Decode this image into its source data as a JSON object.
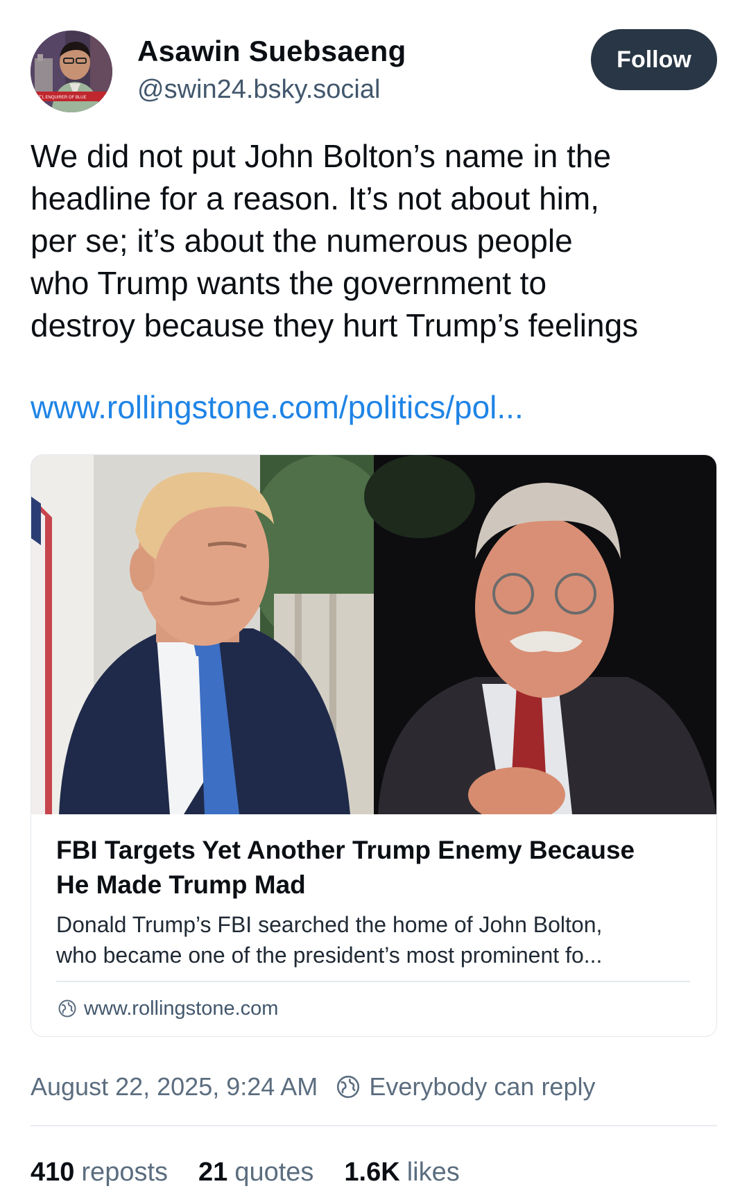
{
  "author": {
    "display_name": "Asawin Suebsaeng",
    "handle": "@swin24.bsky.social",
    "avatar_chyron": "NAT'L ENQUIRER OF BLUE"
  },
  "follow_button": {
    "label": "Follow"
  },
  "post": {
    "text_lines": [
      "We did not put John Bolton’s name in the",
      "headline for a reason. It’s not about him,",
      "per se; it’s about the numerous people",
      "who Trump wants the government to",
      "destroy because they hurt Trump’s feelings"
    ],
    "link_text": "www.rollingstone.com/politics/pol..."
  },
  "link_card": {
    "title_lines": [
      "FBI Targets Yet Another Trump Enemy Because",
      "He Made Trump Mad"
    ],
    "description_lines": [
      "Donald Trump’s FBI searched the home of John Bolton,",
      "who became one of the president’s most prominent fo..."
    ],
    "domain": "www.rollingstone.com",
    "domain_icon": "globe-icon"
  },
  "meta": {
    "timestamp": "August 22, 2025, 9:24 AM",
    "reply_setting": "Everybody can reply",
    "reply_icon": "globe-icon"
  },
  "stats": {
    "reposts": {
      "count": "410",
      "label": "reposts"
    },
    "quotes": {
      "count": "21",
      "label": "quotes"
    },
    "likes": {
      "count": "1.6K",
      "label": "likes"
    }
  },
  "colors": {
    "follow_bg": "#283645",
    "link": "#1f84e6",
    "muted": "#5b6d7f"
  }
}
